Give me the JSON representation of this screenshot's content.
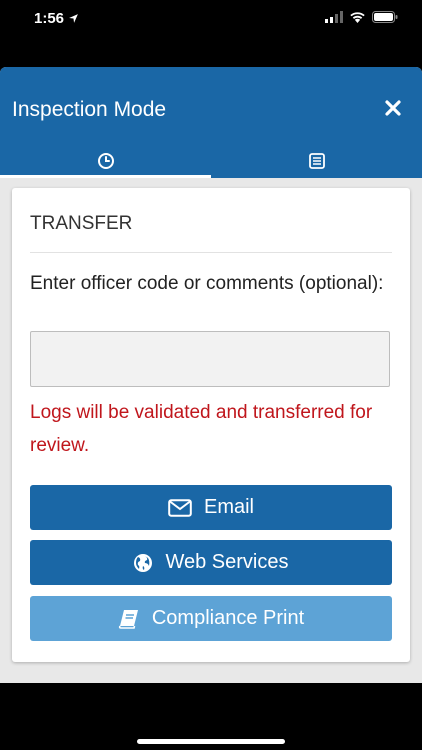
{
  "status_bar": {
    "time": "1:56"
  },
  "header": {
    "title": "Inspection Mode"
  },
  "tabs": [
    {
      "icon": "clock-icon",
      "active": true
    },
    {
      "icon": "clipboard-icon",
      "active": false
    }
  ],
  "transfer": {
    "title": "TRANSFER",
    "prompt": "Enter officer code or comments (optional):",
    "input_value": "",
    "warning": "Logs will be validated and transferred for review."
  },
  "buttons": {
    "email": "Email",
    "web_services": "Web Services",
    "compliance_print": "Compliance Print"
  },
  "colors": {
    "primary": "#1a67a6",
    "primary_light": "#5da3d6",
    "warning": "#c0161c"
  }
}
